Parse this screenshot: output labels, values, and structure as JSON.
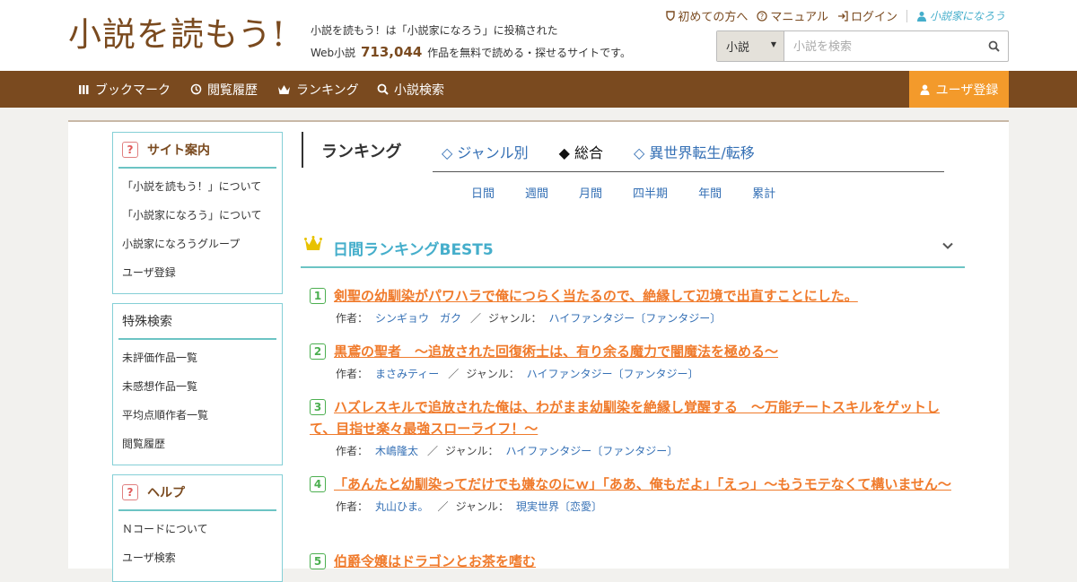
{
  "header": {
    "logo": "小説を読もう!",
    "tagline_line1": "小説を読もう！は「小説家になろう」に投稿された",
    "tagline_prefix": "Web小説",
    "work_count": "713,044",
    "tagline_suffix": "作品を無料で読める・探せるサイトです。",
    "links": [
      "初めての方へ",
      "マニュアル",
      "ログイン"
    ],
    "brand": "小説家になろう"
  },
  "search": {
    "select_value": "小説",
    "placeholder": "小説を検索"
  },
  "nav": {
    "items": [
      "ブックマーク",
      "閲覧履歴",
      "ランキング",
      "小説検索"
    ],
    "register": "ユーザ登録"
  },
  "sidebar": {
    "site_guide": {
      "title": "サイト案内",
      "items": [
        "「小説を読もう！」について",
        "「小説家になろう」について",
        "小説家になろうグループ",
        "ユーザ登録"
      ]
    },
    "special_search": {
      "title": "特殊検索",
      "items": [
        "未評価作品一覧",
        "未感想作品一覧",
        "平均点順作者一覧",
        "閲覧履歴"
      ]
    },
    "help": {
      "title": "ヘルプ",
      "items": [
        "Ｎコードについて",
        "ユーザ検索"
      ]
    }
  },
  "ranking": {
    "title": "ランキング",
    "tabs": [
      "◇ ジャンル別",
      "◆ 総合",
      "◇ 異世界転生/転移"
    ],
    "periods": [
      "日間",
      "週間",
      "月間",
      "四半期",
      "年間",
      "累計"
    ],
    "best_title": "日間ランキングBEST5",
    "author_label": "作者：",
    "genre_label": "ジャンル：",
    "entries": [
      {
        "rank": "1",
        "title": "剣聖の幼馴染がパワハラで俺につらく当たるので、絶縁して辺境で出直すことにした。",
        "author": "シンギョウ　ガク",
        "genre": "ハイファンタジー〔ファンタジー〕"
      },
      {
        "rank": "2",
        "title": "黒鳶の聖者　〜追放された回復術士は、有り余る魔力で闇魔法を極める〜",
        "author": "まさみティー",
        "genre": "ハイファンタジー〔ファンタジー〕"
      },
      {
        "rank": "3",
        "title": "ハズレスキルで追放された俺は、わがまま幼馴染を絶縁し覚醒する　～万能チートスキルをゲットして、目指せ楽々最強スローライフ！～",
        "author": "木嶋隆太",
        "genre": "ハイファンタジー〔ファンタジー〕"
      },
      {
        "rank": "4",
        "title": "「あんたと幼馴染ってだけでも嫌なのにｗ」「ああ、俺もだよ」「えっ」～もうモテなくて構いません～",
        "author": "丸山ひま。",
        "genre": "現実世界〔恋愛〕"
      },
      {
        "rank": "5",
        "title": "伯爵令嬢はドラゴンとお茶を嗜む",
        "author": "",
        "genre": ""
      }
    ]
  },
  "colors": {
    "brand_brown": "#7a4a1f",
    "accent_orange": "#f39a2b",
    "teal": "#45aecb",
    "link_blue": "#3570b5",
    "title_orange": "#f07b2c"
  }
}
